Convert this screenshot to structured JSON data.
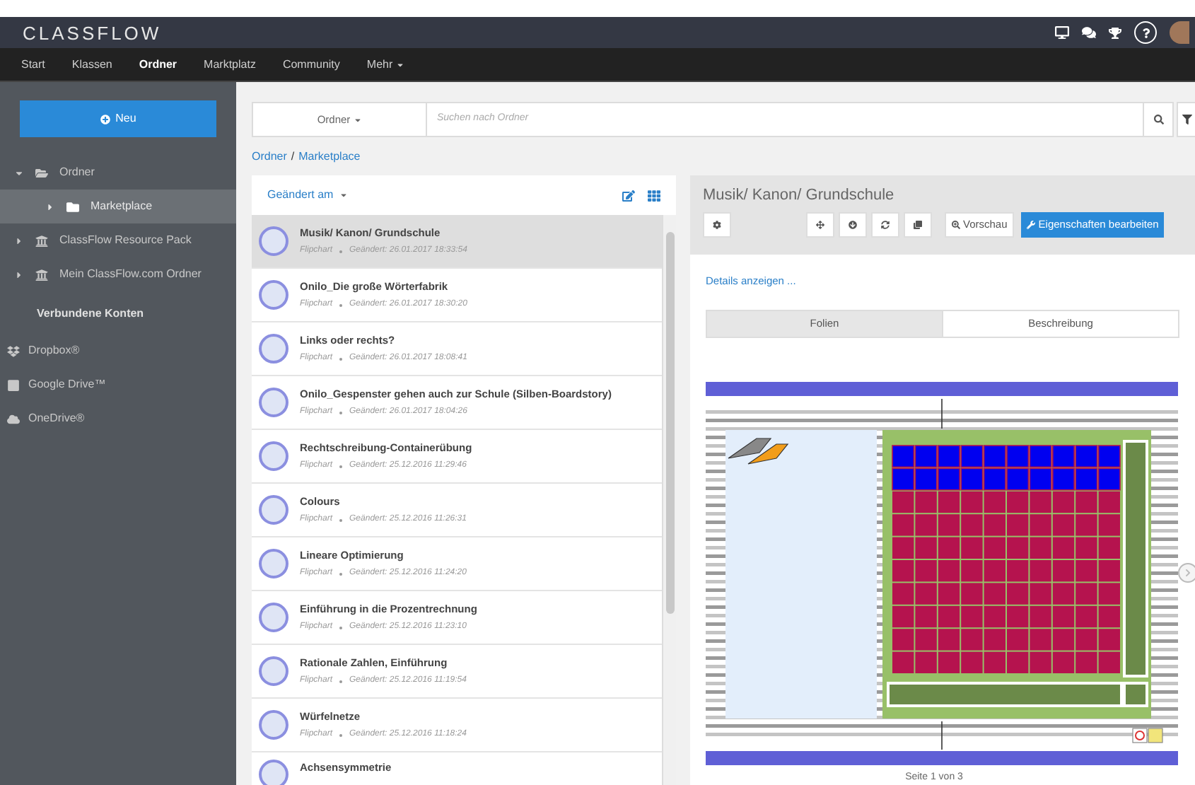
{
  "app": {
    "logo": "CLASSFLOW"
  },
  "nav": [
    {
      "label": "Start",
      "selected": false
    },
    {
      "label": "Klassen",
      "selected": false
    },
    {
      "label": "Ordner",
      "selected": true
    },
    {
      "label": "Marktplatz",
      "selected": false
    },
    {
      "label": "Community",
      "selected": false
    },
    {
      "label": "Mehr",
      "selected": false,
      "dropdown": true
    }
  ],
  "sidebar": {
    "new_button": "Neu",
    "tree": [
      {
        "label": "Ordner",
        "kind": "folder",
        "expanded": true,
        "selected": false,
        "children": [
          {
            "label": "Marketplace",
            "kind": "folder",
            "expanded": false,
            "selected": true
          }
        ]
      },
      {
        "label": "ClassFlow Resource Pack",
        "kind": "library",
        "expanded": false,
        "selected": false
      },
      {
        "label": "Mein ClassFlow.com Ordner",
        "kind": "library",
        "expanded": false,
        "selected": false
      }
    ],
    "accounts_heading": "Verbundene Konten",
    "accounts": [
      {
        "label": "Dropbox®",
        "kind": "dropbox"
      },
      {
        "label": "Google Drive™",
        "kind": "drive"
      },
      {
        "label": "OneDrive®",
        "kind": "cloud"
      }
    ]
  },
  "search": {
    "scope": "Ordner",
    "placeholder": "Suchen nach Ordner"
  },
  "breadcrumb": {
    "separator": "/",
    "items": [
      "Ordner",
      "Marketplace"
    ]
  },
  "list": {
    "sort": "Geändert am",
    "rows": [
      {
        "title": "Musik/ Kanon/ Grundschule",
        "type": "Flipchart",
        "modified": "Geändert: 26.01.2017 18:33:54",
        "selected": true
      },
      {
        "title": "Onilo_Die große Wörterfabrik",
        "type": "Flipchart",
        "modified": "Geändert: 26.01.2017 18:30:20",
        "selected": false
      },
      {
        "title": "Links oder rechts?",
        "type": "Flipchart",
        "modified": "Geändert: 26.01.2017 18:08:41",
        "selected": false
      },
      {
        "title": "Onilo_Gespenster gehen auch zur Schule (Silben-Boardstory)",
        "type": "Flipchart",
        "modified": "Geändert: 26.01.2017 18:04:26",
        "selected": false
      },
      {
        "title": "Rechtschreibung-Containerübung",
        "type": "Flipchart",
        "modified": "Geändert: 25.12.2016 11:29:46",
        "selected": false
      },
      {
        "title": "Colours",
        "type": "Flipchart",
        "modified": "Geändert: 25.12.2016 11:26:31",
        "selected": false
      },
      {
        "title": "Lineare Optimierung",
        "type": "Flipchart",
        "modified": "Geändert: 25.12.2016 11:24:20",
        "selected": false
      },
      {
        "title": "Einführung in die Prozentrechnung",
        "type": "Flipchart",
        "modified": "Geändert: 25.12.2016 11:23:10",
        "selected": false
      },
      {
        "title": "Rationale Zahlen, Einführung",
        "type": "Flipchart",
        "modified": "Geändert: 25.12.2016 11:19:54",
        "selected": false
      },
      {
        "title": "Würfelnetze",
        "type": "Flipchart",
        "modified": "Geändert: 25.12.2016 11:18:24",
        "selected": false
      },
      {
        "title": "Achsensymmetrie",
        "selected": false
      }
    ]
  },
  "detail": {
    "title": "Musik/ Kanon/ Grundschule",
    "preview_button": "Vorschau",
    "edit_button": "Eigenschaften bearbeiten",
    "details_link": "Details anzeigen ...",
    "tabs": [
      {
        "label": "Folien",
        "selected": true
      },
      {
        "label": "Beschreibung",
        "selected": false
      }
    ],
    "page_label": "Seite 1 von 3"
  }
}
